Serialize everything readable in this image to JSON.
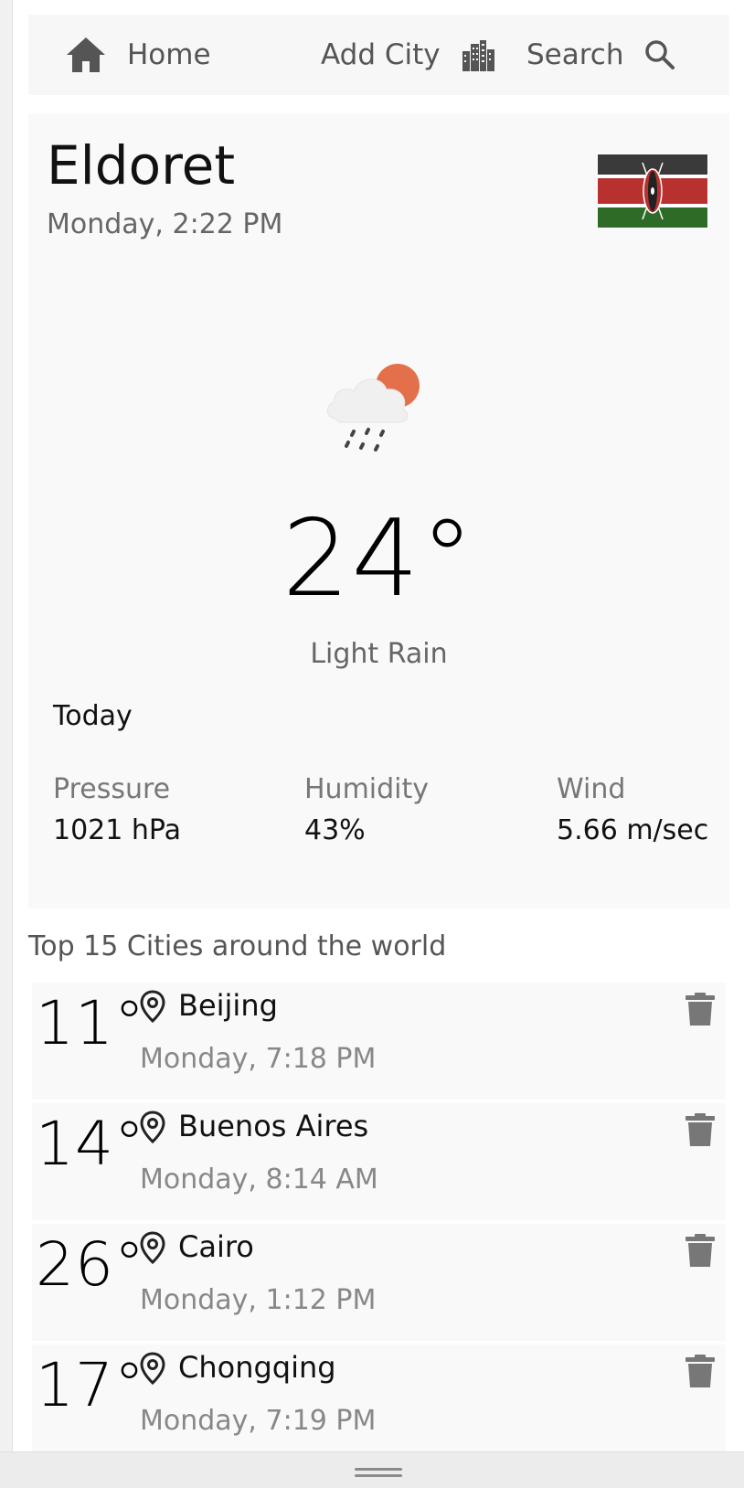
{
  "nav": {
    "home_label": "Home",
    "add_city_label": "Add City",
    "search_label": "Search",
    "icons": {
      "home": "home-icon",
      "add_city": "buildings-icon",
      "search": "search-icon"
    }
  },
  "current": {
    "city": "Eldoret",
    "datetime": "Monday, 2:22 PM",
    "flag": "kenya-flag",
    "weather_icon": "cloud-sun-rain-icon",
    "temperature": "24°",
    "condition": "Light Rain",
    "today_label": "Today",
    "metrics": [
      {
        "label": "Pressure",
        "value": "1021 hPa"
      },
      {
        "label": "Humidity",
        "value": "43%"
      },
      {
        "label": "Wind",
        "value": "5.66 m/sec"
      }
    ]
  },
  "top_cities": {
    "title": "Top 15 Cities around the world",
    "items": [
      {
        "temp": "11°",
        "name": "Beijing",
        "time": "Monday, 7:18 PM"
      },
      {
        "temp": "14°",
        "name": "Buenos Aires",
        "time": "Monday, 8:14 AM"
      },
      {
        "temp": "26°",
        "name": "Cairo",
        "time": "Monday, 1:12 PM"
      },
      {
        "temp": "17°",
        "name": "Chongqing",
        "time": "Monday, 7:19 PM"
      }
    ]
  },
  "colors": {
    "icon_gray": "#555555",
    "sun": "#e46f4b",
    "flag_black": "#3a3a3a",
    "flag_red": "#b8312f",
    "flag_green": "#2e6b26"
  }
}
